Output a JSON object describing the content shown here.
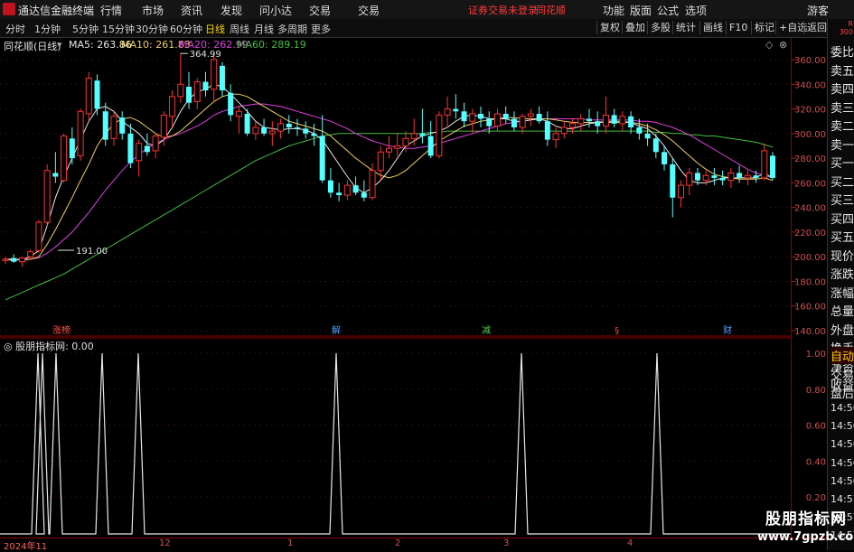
{
  "app": {
    "title": "通达信金融终端"
  },
  "menu": [
    "行情",
    "市场",
    "资讯",
    "发现",
    "问小达",
    "交易"
  ],
  "warning": "证券交易未登录",
  "brand": "同花顺",
  "menu_right": [
    "功能",
    "版面",
    "公式",
    "选项"
  ],
  "user": "游客",
  "corner_badge": [
    "R",
    "300"
  ],
  "periods": [
    "分时",
    "1分钟",
    "5分钟",
    "15分钟",
    "30分钟",
    "60分钟",
    "日线",
    "周线",
    "月线",
    "多周期",
    "更多"
  ],
  "active_period": "日线",
  "toolbar_right": [
    "复权",
    "叠加",
    "多股",
    "统计",
    "画线",
    "F10",
    "标记",
    "+自选",
    "返回"
  ],
  "stock_title": "同花顺(日线)",
  "ma": [
    {
      "label": "MA5: 263.86",
      "color": "#e8e8e8"
    },
    {
      "label": "MA10: 261.83",
      "color": "#f0d060"
    },
    {
      "label": "MA20: 262.99",
      "color": "#e040e0"
    },
    {
      "label": "MA60: 289.19",
      "color": "#40c040"
    }
  ],
  "high_label": "364.99",
  "low_label": "191.00",
  "y_labels": [
    "360.00",
    "340.00",
    "320.00",
    "300.00",
    "280.00",
    "260.00",
    "240.00",
    "220.00",
    "200.00",
    "180.00",
    "160.00",
    "140.00"
  ],
  "events": [
    {
      "label": "涨榜",
      "color": "#ff5050"
    },
    {
      "label": "解",
      "color": "#50a0ff"
    },
    {
      "label": "减",
      "color": "#50d050"
    },
    {
      "label": "§",
      "color": "#ff4040"
    },
    {
      "label": "财",
      "color": "#50a0ff"
    }
  ],
  "indicator": {
    "name": "股朋指标网",
    "value": ": 0.00"
  },
  "ind_y_labels": [
    "1.00",
    "0.80",
    "0.60",
    "0.40",
    "0.20"
  ],
  "side_panel": [
    "委比",
    "卖五",
    "卖四",
    "卖三",
    "卖二",
    "卖一",
    "买一",
    "买二",
    "买三",
    "买四",
    "买五",
    "现价",
    "涨跌",
    "涨幅",
    "总量",
    "外盘",
    "换手",
    "净资",
    "收益"
  ],
  "side_panel2": [
    "自动",
    "交易",
    "盘后"
  ],
  "side_times": [
    "14:56",
    "14:56",
    "14:56",
    "14:56",
    "14:56",
    "14:57",
    "14:57",
    "14:57"
  ],
  "dates": [
    "2024年11",
    "12",
    "1",
    "2",
    "3",
    "4"
  ],
  "watermark": {
    "title": "股朋指标网",
    "url": "www.7gpzb.com"
  },
  "chart_data": {
    "type": "candlestick",
    "ylim": [
      130,
      370
    ],
    "ohlc": [
      [
        197,
        200,
        194,
        198
      ],
      [
        199,
        202,
        195,
        196
      ],
      [
        196,
        200,
        192,
        199
      ],
      [
        200,
        206,
        198,
        204
      ],
      [
        205,
        230,
        203,
        228
      ],
      [
        228,
        275,
        225,
        270
      ],
      [
        268,
        285,
        260,
        265
      ],
      [
        262,
        300,
        260,
        298
      ],
      [
        296,
        305,
        275,
        280
      ],
      [
        282,
        320,
        278,
        318
      ],
      [
        316,
        350,
        310,
        345
      ],
      [
        343,
        348,
        315,
        320
      ],
      [
        318,
        325,
        290,
        295
      ],
      [
        296,
        318,
        290,
        314
      ],
      [
        313,
        318,
        295,
        300
      ],
      [
        300,
        308,
        272,
        276
      ],
      [
        278,
        295,
        265,
        292
      ],
      [
        290,
        300,
        282,
        285
      ],
      [
        286,
        300,
        280,
        298
      ],
      [
        297,
        318,
        290,
        315
      ],
      [
        314,
        335,
        305,
        330
      ],
      [
        330,
        365,
        325,
        340
      ],
      [
        338,
        350,
        320,
        325
      ],
      [
        326,
        345,
        320,
        342
      ],
      [
        342,
        350,
        330,
        335
      ],
      [
        336,
        365,
        325,
        360
      ],
      [
        355,
        358,
        330,
        335
      ],
      [
        333,
        340,
        310,
        315
      ],
      [
        314,
        322,
        300,
        318
      ],
      [
        316,
        320,
        298,
        300
      ],
      [
        300,
        310,
        295,
        305
      ],
      [
        305,
        312,
        298,
        300
      ],
      [
        300,
        310,
        290,
        302
      ],
      [
        302,
        312,
        296,
        308
      ],
      [
        308,
        315,
        300,
        305
      ],
      [
        305,
        312,
        298,
        304
      ],
      [
        304,
        310,
        296,
        300
      ],
      [
        300,
        308,
        290,
        298
      ],
      [
        298,
        315,
        260,
        262
      ],
      [
        262,
        272,
        248,
        252
      ],
      [
        252,
        260,
        245,
        250
      ],
      [
        250,
        262,
        246,
        258
      ],
      [
        258,
        265,
        250,
        252
      ],
      [
        252,
        262,
        245,
        248
      ],
      [
        248,
        276,
        246,
        270
      ],
      [
        270,
        290,
        262,
        285
      ],
      [
        285,
        298,
        280,
        288
      ],
      [
        288,
        300,
        282,
        290
      ],
      [
        290,
        302,
        285,
        296
      ],
      [
        296,
        312,
        290,
        300
      ],
      [
        300,
        320,
        292,
        298
      ],
      [
        298,
        310,
        280,
        282
      ],
      [
        282,
        318,
        280,
        315
      ],
      [
        315,
        330,
        305,
        320
      ],
      [
        320,
        332,
        312,
        318
      ],
      [
        318,
        325,
        305,
        310
      ],
      [
        310,
        320,
        300,
        316
      ],
      [
        316,
        322,
        305,
        312
      ],
      [
        312,
        318,
        300,
        306
      ],
      [
        306,
        320,
        302,
        316
      ],
      [
        316,
        322,
        308,
        312
      ],
      [
        312,
        318,
        302,
        305
      ],
      [
        305,
        316,
        300,
        314
      ],
      [
        314,
        320,
        306,
        316
      ],
      [
        316,
        322,
        308,
        310
      ],
      [
        310,
        318,
        290,
        295
      ],
      [
        295,
        305,
        288,
        300
      ],
      [
        300,
        310,
        296,
        305
      ],
      [
        305,
        312,
        300,
        308
      ],
      [
        308,
        316,
        302,
        312
      ],
      [
        312,
        320,
        305,
        310
      ],
      [
        310,
        318,
        300,
        306
      ],
      [
        306,
        330,
        300,
        315
      ],
      [
        315,
        320,
        305,
        308
      ],
      [
        308,
        318,
        302,
        314
      ],
      [
        314,
        318,
        300,
        305
      ],
      [
        305,
        312,
        295,
        300
      ],
      [
        300,
        308,
        290,
        296
      ],
      [
        296,
        300,
        280,
        285
      ],
      [
        285,
        290,
        270,
        275
      ],
      [
        275,
        280,
        232,
        248
      ],
      [
        248,
        262,
        240,
        258
      ],
      [
        258,
        272,
        250,
        268
      ],
      [
        268,
        272,
        258,
        262
      ],
      [
        262,
        270,
        258,
        266
      ],
      [
        266,
        272,
        258,
        264
      ],
      [
        264,
        270,
        258,
        262
      ],
      [
        262,
        272,
        256,
        268
      ],
      [
        268,
        274,
        260,
        264
      ],
      [
        264,
        270,
        258,
        266
      ],
      [
        266,
        270,
        260,
        264
      ],
      [
        264,
        292,
        262,
        286
      ],
      [
        282,
        285,
        262,
        264
      ]
    ],
    "ma5": [
      198,
      197,
      198,
      200,
      205,
      225,
      248,
      265,
      280,
      295,
      310,
      320,
      322,
      318,
      310,
      305,
      300,
      292,
      290,
      295,
      305,
      318,
      328,
      334,
      336,
      340,
      338,
      332,
      325,
      318,
      310,
      305,
      304,
      303,
      304,
      304,
      303,
      300,
      295,
      285,
      275,
      265,
      256,
      252,
      256,
      262,
      270,
      280,
      290,
      294,
      298,
      300,
      302,
      305,
      310,
      314,
      315,
      314,
      312,
      312,
      312,
      310,
      310,
      311,
      312,
      310,
      306,
      304,
      304,
      306,
      308,
      309,
      310,
      310,
      310,
      309,
      306,
      304,
      298,
      290,
      280,
      270,
      262,
      260,
      260,
      262,
      264,
      264,
      264,
      264,
      264,
      268,
      264
    ],
    "ma10": [
      198,
      198,
      197,
      198,
      200,
      210,
      222,
      235,
      248,
      262,
      275,
      290,
      300,
      308,
      312,
      313,
      310,
      305,
      300,
      297,
      298,
      302,
      308,
      314,
      320,
      326,
      330,
      332,
      332,
      330,
      326,
      322,
      318,
      314,
      310,
      308,
      306,
      304,
      302,
      298,
      292,
      286,
      280,
      275,
      270,
      266,
      264,
      266,
      270,
      276,
      282,
      288,
      294,
      298,
      302,
      306,
      308,
      310,
      311,
      312,
      313,
      313,
      312,
      312,
      312,
      312,
      311,
      310,
      309,
      309,
      309,
      309,
      309,
      309,
      309,
      309,
      308,
      306,
      303,
      299,
      294,
      288,
      282,
      276,
      271,
      267,
      265,
      264,
      263,
      263,
      263,
      264,
      262
    ],
    "ma20": [
      198,
      198,
      198,
      198,
      199,
      203,
      208,
      214,
      220,
      228,
      236,
      245,
      254,
      262,
      270,
      277,
      283,
      288,
      292,
      295,
      298,
      300,
      303,
      306,
      310,
      315,
      318,
      320,
      322,
      323,
      324,
      324,
      323,
      322,
      320,
      318,
      316,
      314,
      312,
      310,
      307,
      304,
      300,
      297,
      294,
      292,
      290,
      289,
      288,
      288,
      289,
      290,
      292,
      294,
      296,
      298,
      300,
      302,
      304,
      306,
      308,
      309,
      310,
      311,
      312,
      312,
      312,
      312,
      312,
      312,
      311,
      311,
      311,
      311,
      311,
      311,
      310,
      310,
      309,
      307,
      305,
      302,
      299,
      295,
      291,
      287,
      283,
      279,
      275,
      271,
      268,
      266,
      264
    ],
    "ma60": [
      165,
      168,
      171,
      174,
      177,
      180,
      183,
      186,
      190,
      194,
      198,
      202,
      206,
      210,
      214,
      218,
      222,
      226,
      230,
      234,
      238,
      242,
      246,
      250,
      254,
      258,
      262,
      266,
      270,
      274,
      278,
      281,
      284,
      287,
      290,
      292,
      294,
      296,
      298,
      299,
      300,
      300,
      300,
      300,
      300,
      300,
      300,
      300,
      300,
      300,
      300,
      301,
      301,
      302,
      302,
      302,
      302,
      302,
      302,
      302,
      302,
      302,
      302,
      302,
      302,
      302,
      302,
      302,
      302,
      302,
      302,
      302,
      302,
      302,
      302,
      302,
      302,
      302,
      301,
      301,
      300,
      300,
      299,
      299,
      298,
      298,
      297,
      296,
      295,
      294,
      293,
      291,
      289
    ],
    "signal_peaks": [
      42,
      47,
      62,
      113,
      153,
      372,
      577,
      727
    ],
    "ind_ylim": [
      0,
      1.05
    ]
  }
}
